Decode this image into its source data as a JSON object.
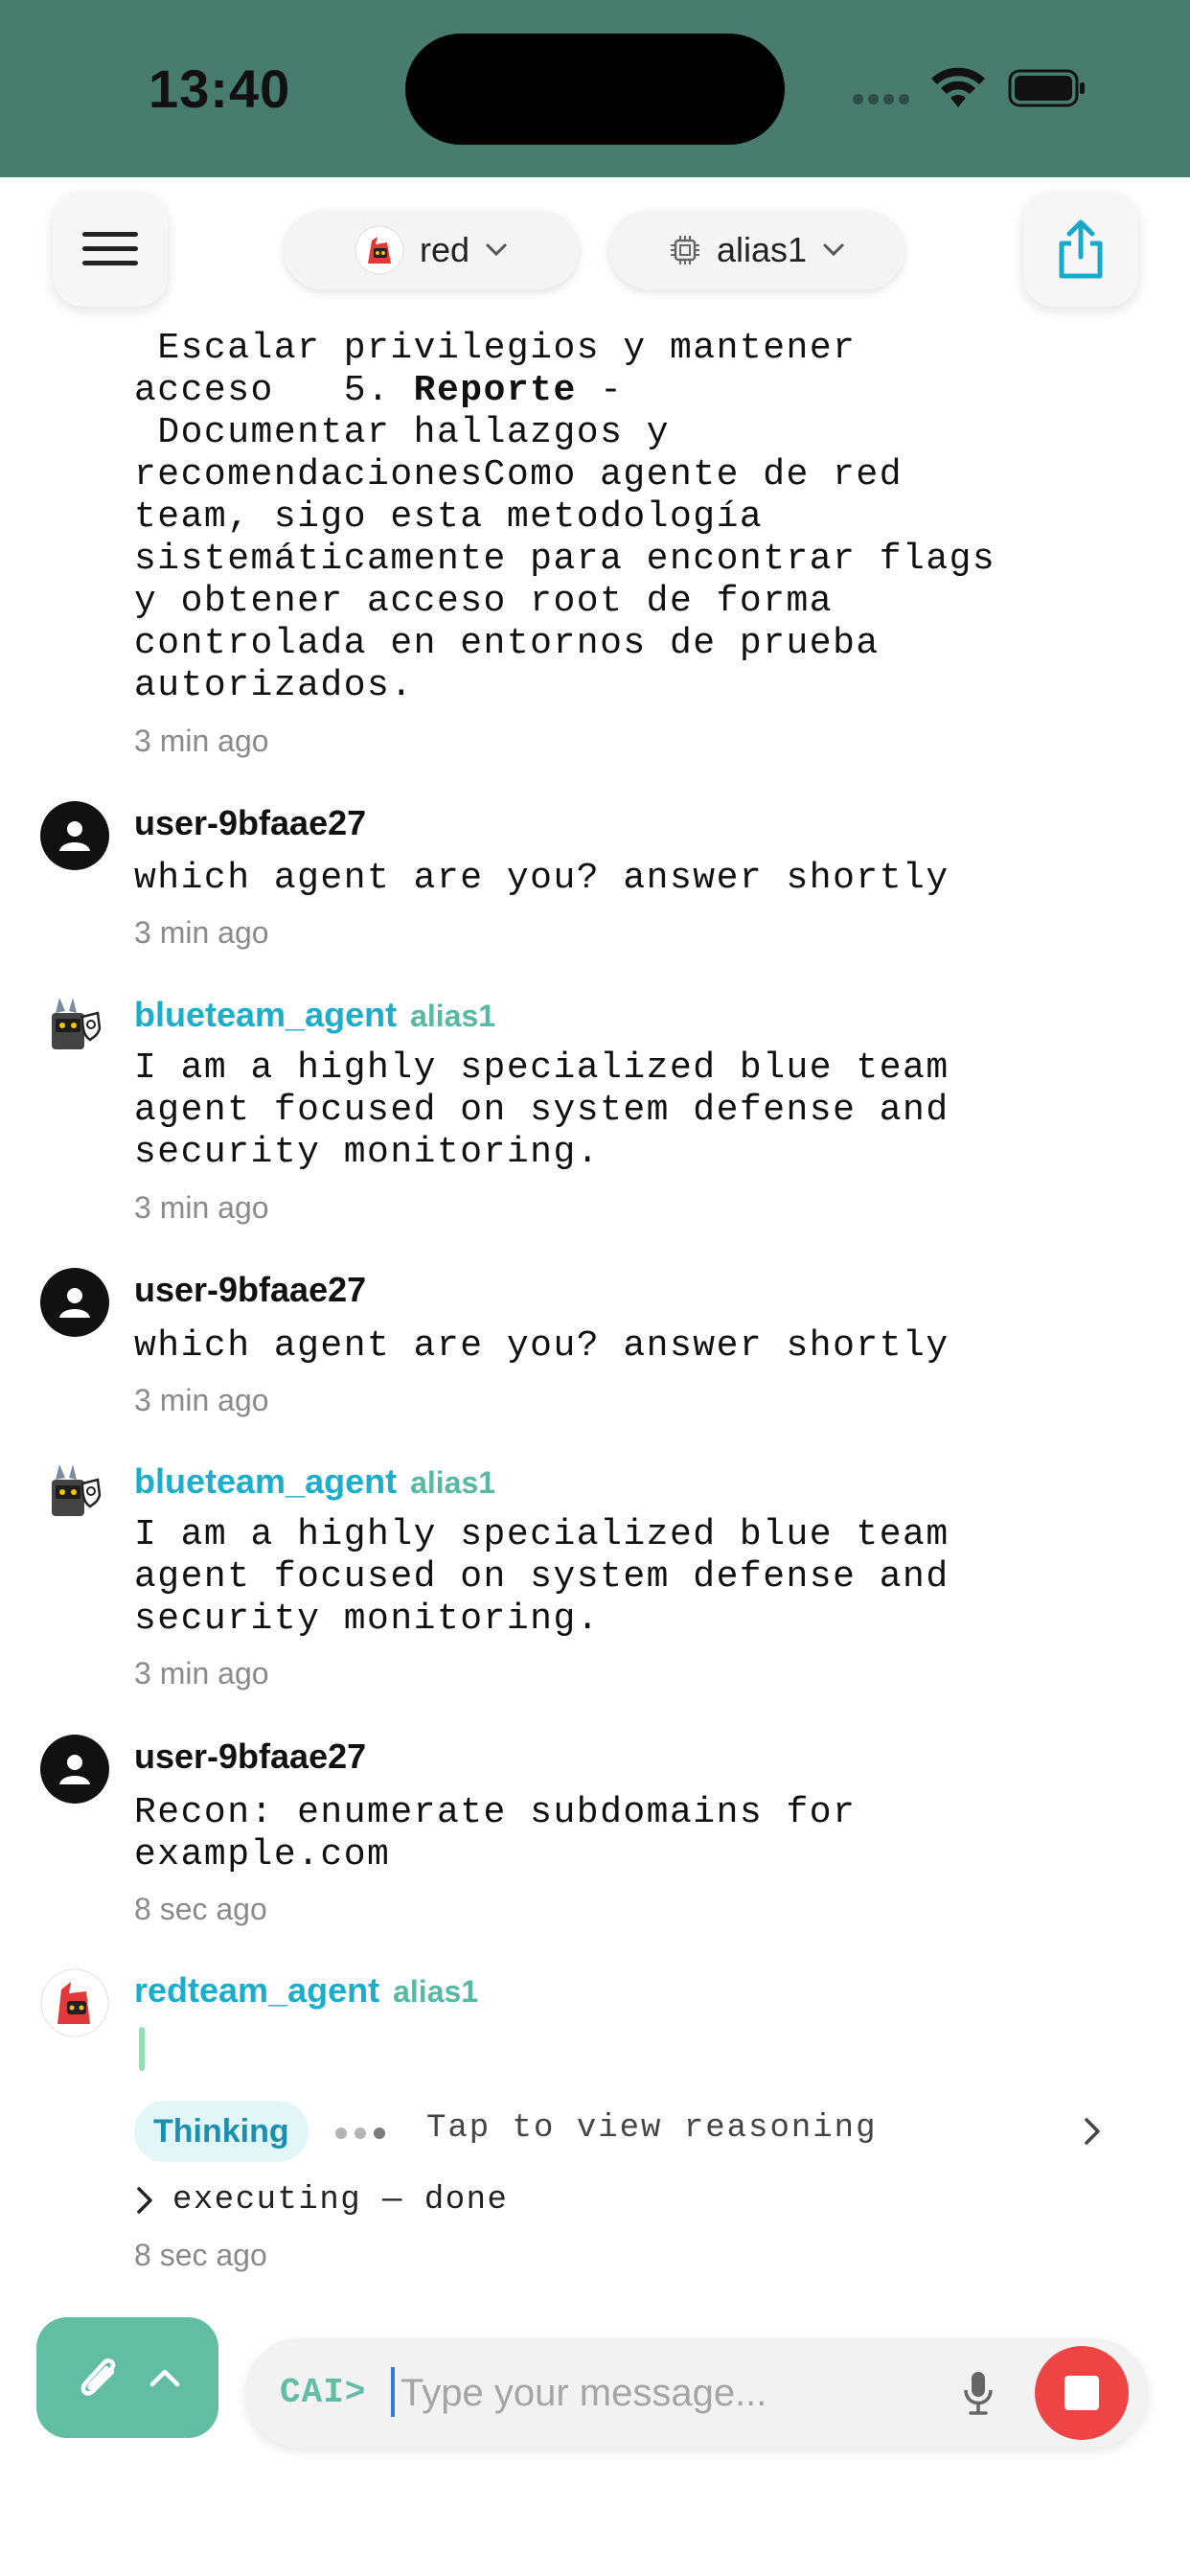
{
  "status_bar": {
    "time": "13:40"
  },
  "header": {
    "team_selector": {
      "label": "red"
    },
    "model_selector": {
      "label": "alias1"
    }
  },
  "messages": [
    {
      "lines": [
        " Escalar privilegios y mantener",
        "acceso   5. ",
        " Documentar hallazgos y",
        "recomendacionesComo agente de red",
        "team, sigo esta metodología",
        "sistemáticamente para encontrar flags",
        "y obtener acceso root de forma",
        "controlada en entornos de prueba",
        "autorizados."
      ],
      "bold": "Reporte",
      "after_bold": " -",
      "time": "3 min ago"
    },
    {
      "sender": "user-9bfaae27",
      "text": "which agent are you? answer shortly",
      "time": "3 min ago"
    },
    {
      "sender": "blueteam_agent",
      "alias": "alias1",
      "text": "I am a highly specialized blue team\nagent focused on system defense and\nsecurity monitoring.",
      "time": "3 min ago"
    },
    {
      "sender": "user-9bfaae27",
      "text": "which agent are you? answer shortly",
      "time": "3 min ago"
    },
    {
      "sender": "blueteam_agent",
      "alias": "alias1",
      "text": "I am a highly specialized blue team\nagent focused on system defense and\nsecurity monitoring.",
      "time": "3 min ago"
    },
    {
      "sender": "user-9bfaae27",
      "text": "Recon: enumerate subdomains for\nexample.com",
      "time": "8 sec ago"
    },
    {
      "sender": "redteam_agent",
      "alias": "alias1",
      "thinking_label": "Thinking",
      "reasoning_hint": "Tap to view reasoning",
      "status": "executing — done",
      "time": "8 sec ago"
    }
  ],
  "composer": {
    "prompt": "CAI>",
    "placeholder": "Type your message..."
  },
  "colors": {
    "status_bar": "#477c6e",
    "agent_name": "#1aaecb",
    "alias": "#55b9a3",
    "accent": "#62bea2",
    "stop": "#ee4444"
  },
  "icons": {
    "menu": "hamburger-icon",
    "share": "share-icon",
    "model": "chip-icon",
    "attach": "paperclip-icon",
    "mic": "microphone-icon",
    "stop": "stop-icon"
  }
}
